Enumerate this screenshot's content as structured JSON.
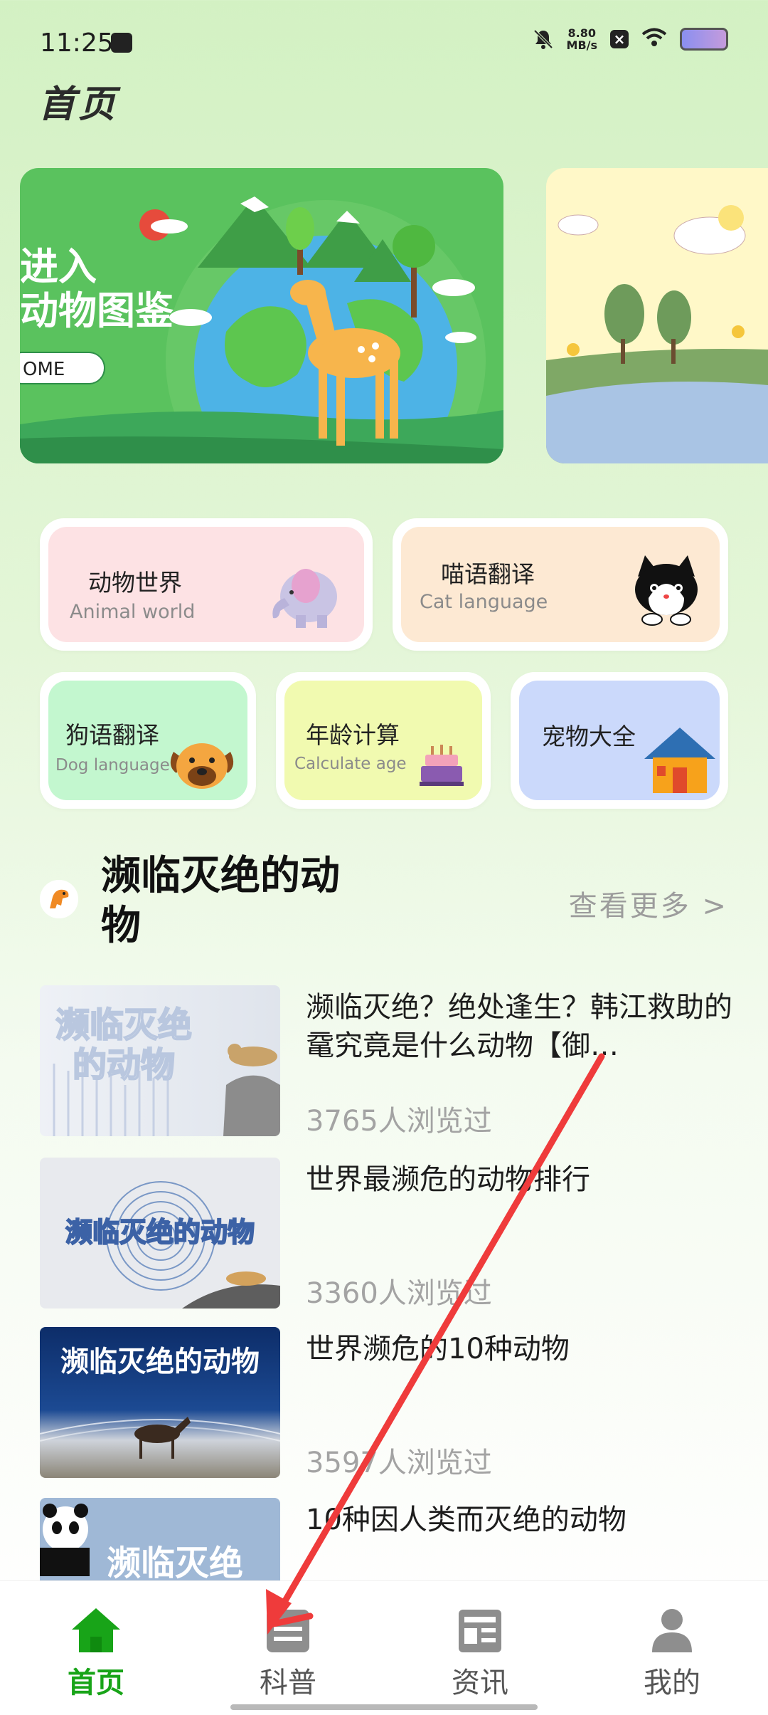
{
  "status_bar": {
    "time": "11:25",
    "network_speed_value": "8.80",
    "network_speed_unit": "MB/s"
  },
  "page_title": "首页",
  "banners": [
    {
      "text_line1": "进入",
      "text_line2": "动物图鉴",
      "button_label": "OME"
    },
    {
      "text": ""
    }
  ],
  "features": [
    {
      "title": "动物世界",
      "subtitle": "Animal world",
      "icon": "elephant-icon",
      "color": "#fde2e4"
    },
    {
      "title": "喵语翻译",
      "subtitle": "Cat language",
      "icon": "cat-icon",
      "color": "#fde9d3"
    },
    {
      "title": "狗语翻译",
      "subtitle": "Dog language",
      "icon": "dog-icon",
      "color": "#c3f7cf"
    },
    {
      "title": "年龄计算",
      "subtitle": "Calculate age",
      "icon": "cake-icon",
      "color": "#f1fab0"
    },
    {
      "title": "宠物大全",
      "subtitle": "",
      "icon": "house-icon",
      "color": "#cbd9fb"
    }
  ],
  "section": {
    "title": "濒临灭绝的动物",
    "more_label": "查看更多 >"
  },
  "articles": [
    {
      "thumb_text": "濒临灭绝的动物",
      "title": "濒临灭绝？绝处逢生？韩江救助的鼋究竟是什么动物【御…",
      "views": "3765人浏览过"
    },
    {
      "thumb_text": "濒临灭绝的动物",
      "title": "世界最濒危的动物排行",
      "views": "3360人浏览过"
    },
    {
      "thumb_text": "濒临灭绝的动物",
      "title": "世界濒危的10种动物",
      "views": "3597人浏览过"
    },
    {
      "thumb_text": "濒临灭绝",
      "title": "10种因人类而灭绝的动物",
      "views": ""
    }
  ],
  "bottom_nav": [
    {
      "label": "首页",
      "icon": "home-icon",
      "active": true
    },
    {
      "label": "科普",
      "icon": "book-icon",
      "active": false
    },
    {
      "label": "资讯",
      "icon": "news-icon",
      "active": false
    },
    {
      "label": "我的",
      "icon": "user-icon",
      "active": false
    }
  ],
  "colors": {
    "accent_green": "#18a418",
    "annotation_arrow": "#ef3b3b"
  }
}
